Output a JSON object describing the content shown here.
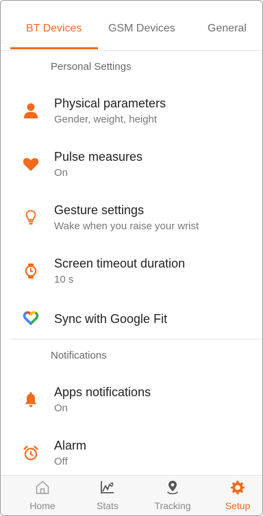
{
  "tabs": [
    {
      "label": "BT Devices",
      "active": true
    },
    {
      "label": "GSM Devices",
      "active": false
    },
    {
      "label": "General",
      "active": false
    }
  ],
  "sections": {
    "personal": {
      "header": "Personal Settings",
      "items": [
        {
          "icon": "person-icon",
          "title": "Physical parameters",
          "subtitle": "Gender, weight, height"
        },
        {
          "icon": "heart-icon",
          "title": "Pulse measures",
          "subtitle": "On"
        },
        {
          "icon": "gesture-lightbulb-icon",
          "title": "Gesture settings",
          "subtitle": "Wake when you raise your wrist"
        },
        {
          "icon": "watch-timer-icon",
          "title": "Screen timeout duration",
          "subtitle": "10 s"
        },
        {
          "icon": "google-fit-icon",
          "title": "Sync with Google Fit",
          "subtitle": ""
        }
      ]
    },
    "notifications": {
      "header": "Notifications",
      "items": [
        {
          "icon": "bell-icon",
          "title": "Apps notifications",
          "subtitle": "On"
        },
        {
          "icon": "alarm-clock-icon",
          "title": "Alarm",
          "subtitle": "Off"
        }
      ]
    }
  },
  "bottom_nav": [
    {
      "icon": "home-icon",
      "label": "Home",
      "active": false
    },
    {
      "icon": "stats-icon",
      "label": "Stats",
      "active": false
    },
    {
      "icon": "location-pin-icon",
      "label": "Tracking",
      "active": false
    },
    {
      "icon": "gear-icon",
      "label": "Setup",
      "active": true
    }
  ],
  "colors": {
    "accent": "#f26a1b",
    "text_primary": "#222222",
    "text_secondary": "#777777",
    "nav_background": "#f7f7f7"
  }
}
